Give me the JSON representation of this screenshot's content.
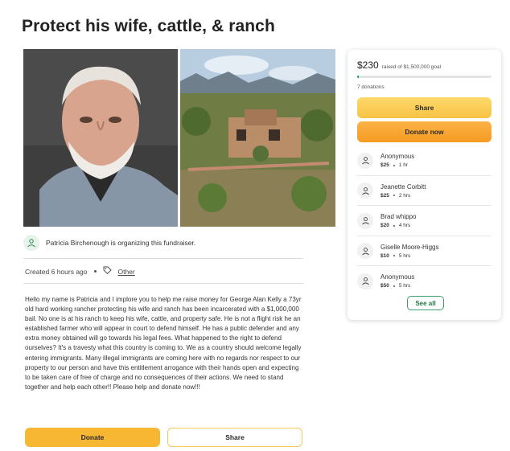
{
  "campaign": {
    "title": "Protect his wife, cattle, & ranch"
  },
  "organizer": {
    "text": "Patricia Birchenough is organizing this fundraiser."
  },
  "meta": {
    "created": "Created 6 hours ago",
    "category": "Other"
  },
  "story": "Hello my name is Patricia and I implore you to help me raise money for George Alan Kelly a 73yr old hard working rancher protecting his wife and ranch has been incarcerated with a $1,000,000 bail. No one is at his ranch to keep his wife, cattle, and property safe. He is not a flight risk he an established farmer who will appear in court to defend himself. He has a public defender and any extra money obtained will go towards his legal fees. What happened to the right to defend ourselves? It's a travesty what this country is coming to. We as a country should welcome legally entering immigrants. Many illegal immigrants are coming here with no regards nor respect to our property to our person and have this entitlement arrogance with their hands open and expecting to be taken care of free of charge and no consequences of their actions. We need to stand together and help each other!! Please help and donate now!!!",
  "buttons": {
    "donate": "Donate",
    "share": "Share"
  },
  "sidebar": {
    "raised_amount": "$230",
    "raised_goal": "raised of $1,500,000 goal",
    "progress_fraction": 0.00015,
    "donations_count": "7 donations",
    "share_label": "Share",
    "donate_label": "Donate now",
    "donors": [
      {
        "name": "Anonymous",
        "amount": "$25",
        "time": "1 hr"
      },
      {
        "name": "Jeanette Corbitt",
        "amount": "$25",
        "time": "2 hrs"
      },
      {
        "name": "Brad whippo",
        "amount": "$20",
        "time": "4 hrs"
      },
      {
        "name": "Giselle Moore-Higgs",
        "amount": "$10",
        "time": "5 hrs"
      },
      {
        "name": "Anonymous",
        "amount": "$50",
        "time": "5 hrs"
      }
    ],
    "see_all_label": "See all"
  },
  "colors": {
    "accent_yellow": "#f7b733",
    "donate_orange": "#f59b22",
    "progress_green": "#02a95c"
  }
}
